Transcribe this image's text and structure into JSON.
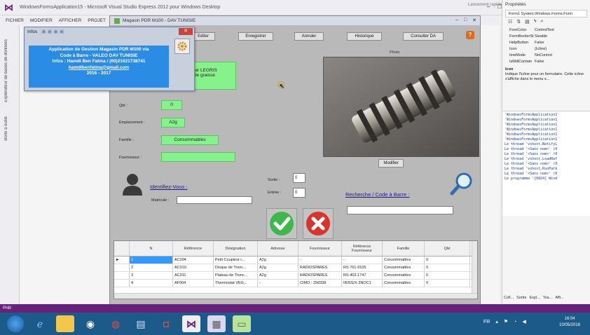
{
  "vs": {
    "title": "WindowsFormsApplication15 - Microsoft Visual Studio Express 2012 pour Windows Desktop",
    "quick_launch": "Lancement rapide",
    "menu": [
      "FICHIER",
      "MODIFIER",
      "AFFICHER",
      "PROJET"
    ],
    "left_tabs": [
      "Explorateur de bases de données",
      "Boîte à outils"
    ],
    "status": "Prêt"
  },
  "form": {
    "title": "Magasin PDR M100 - DAV TUNISIE",
    "toolbar_buttons": [
      "Editer",
      "Enregistrer",
      "Annuler",
      "Historique",
      "Consulter DA"
    ],
    "help_label": "?",
    "info_text": "ler LEGRIS\nde graisse",
    "fields": {
      "qte_label": "Qté :",
      "qte_value": "0",
      "emplacement_label": "Emplacement :",
      "emplacement_value": "A2g",
      "famille_label": "Famille :",
      "famille_value": "Consommables",
      "fournisseur_label": "Fournisseur :",
      "fournisseur_value": ""
    },
    "photo_label": "Photo",
    "modifier_button": "Modifier",
    "identify_link": "Identifiez-Vous :",
    "matricule_label": "Matricule :",
    "sortie_label": "Sortie :",
    "sortie_value": "0",
    "entree_label": "Entrée :",
    "entree_value": "0",
    "barcode_link": "Recherche / Code à Barre :",
    "grid": {
      "headers": [
        "",
        "N",
        "Référence",
        "Désignation",
        "Adresse",
        "Fournisseur",
        "Référence Fournisseur",
        "Famille",
        "Qté"
      ],
      "rows": [
        [
          "►",
          "1",
          "AC004",
          "Petit Coupleur i...",
          "A2g",
          "-",
          "-",
          "Consommables",
          "0"
        ],
        [
          "",
          "2",
          "AC010",
          "Disque de Tronc...",
          "A2g",
          "RADIOSPARES",
          "RS 761-9105",
          "Consommables",
          "0"
        ],
        [
          "",
          "3",
          "AC011",
          "Plateau de Tronc...",
          "A2g",
          "RADIOSPARES",
          "RS 403-1747",
          "Consommables",
          "0"
        ],
        [
          "",
          "4",
          "AF004",
          "Thermostat VEG...",
          "-",
          "CIMO : 258338",
          "IRISS/X-3NOC1",
          "Consommables",
          "0"
        ]
      ]
    }
  },
  "infos": {
    "title": "Infos",
    "lines": [
      "Application de Gestion Magasin PDR M100 via",
      "Code à Barre - VALEO DAV TUNISIE",
      "Infos : Hamdi Ben Fatma / (00)21621738741",
      "hamdibenfatma@gmail.com",
      "2016 - 2017"
    ]
  },
  "props": {
    "title": "Propriétés",
    "object": "Form1 System.Windows.Forms.Form",
    "rows": [
      {
        "name": "ForeColor",
        "value": "ControlText"
      },
      {
        "name": "FormBorderSt",
        "value": "Sizable"
      },
      {
        "name": "HelpButton",
        "value": "False"
      },
      {
        "name": "Icon",
        "value": "(Icône)"
      },
      {
        "name": "ImeMode",
        "value": "NoControl"
      },
      {
        "name": "IsMdiContain",
        "value": "False"
      }
    ],
    "desc_title": "Icon",
    "desc_text": "Indique l'icône pour un formulaire. Cette icône s'affiche dans le menu s...",
    "output_lines": [
      "'WindowsFormsApplication1",
      "'WindowsFormsApplication1",
      "'WindowsFormsApplication1",
      "'WindowsFormsApplication1",
      "'WindowsFormsApplication1",
      "'WindowsFormsApplication1",
      "Le thread 'vshost.NotifyL",
      "Le thread '<Sans nom>' (0",
      "Le thread '<Sans nom>' (0",
      "Le thread 'vshost.LoadRef",
      "Le thread '<Sans nom>' (0",
      "Le thread 'vshost.RunPark",
      "Le thread '<Sans nom>' (0",
      "Le programme '[6824] Wind"
    ],
    "tabs": [
      "Coll...",
      "Sortie",
      "Expl...",
      "Tea...",
      "Affi..."
    ]
  },
  "taskbar": {
    "time": "16:04",
    "date": "10/05/2016"
  }
}
